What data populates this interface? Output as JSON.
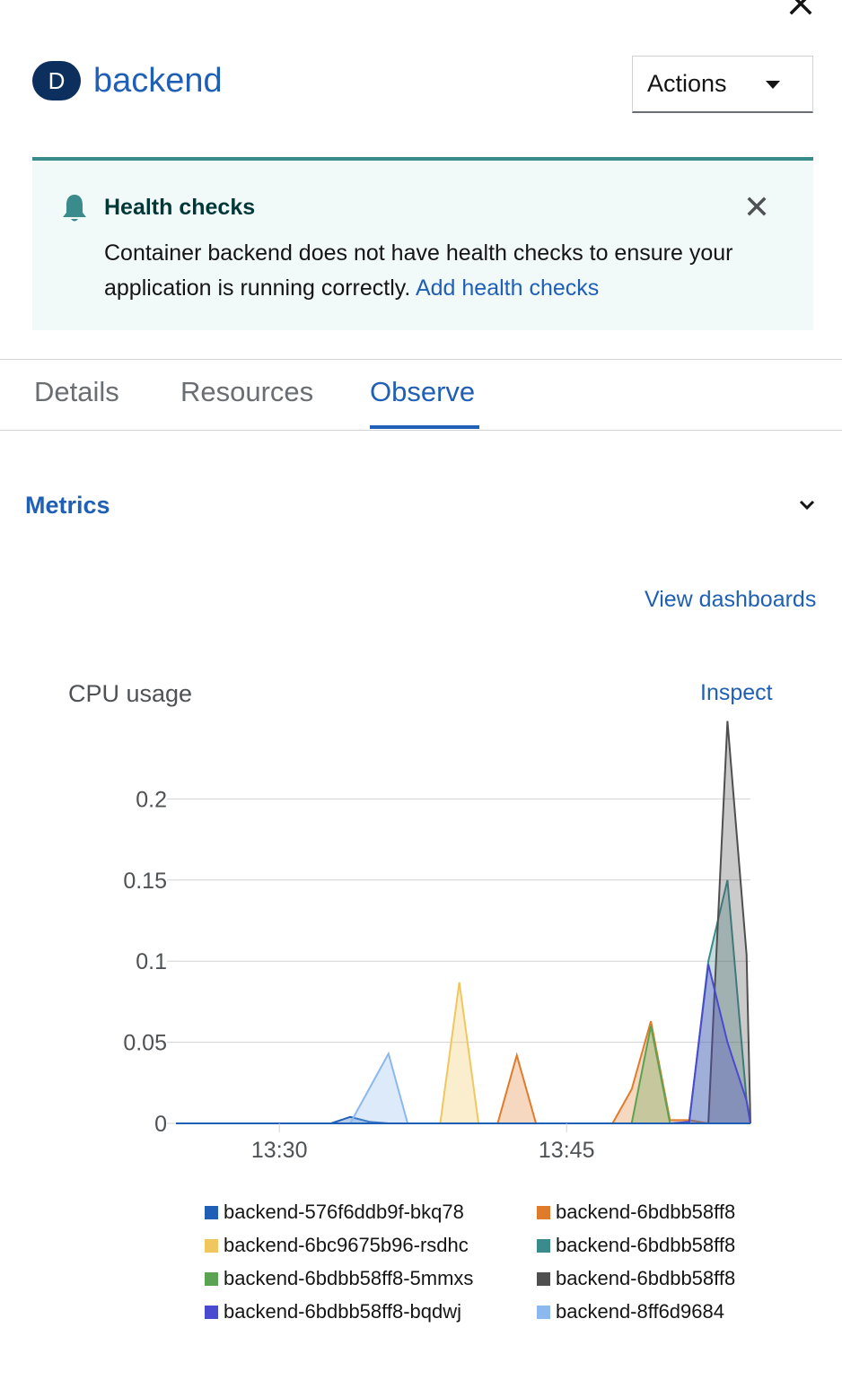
{
  "panel": {
    "close_icon": "close-icon",
    "kind_badge": "D",
    "resource_name": "backend",
    "actions_label": "Actions"
  },
  "alert": {
    "icon": "bell-icon",
    "title": "Health checks",
    "body": "Container backend does not have health checks to ensure your application is running correctly.",
    "link": "Add health checks"
  },
  "tabs": [
    {
      "label": "Details",
      "active": false
    },
    {
      "label": "Resources",
      "active": false
    },
    {
      "label": "Observe",
      "active": true
    }
  ],
  "metrics": {
    "title": "Metrics",
    "view_dashboards": "View dashboards",
    "card_title": "CPU usage",
    "inspect": "Inspect"
  },
  "chart_data": {
    "type": "area",
    "title": "CPU usage",
    "x_ticks": [
      "13:30",
      "13:45"
    ],
    "x_tick_minutes": [
      30,
      45
    ],
    "x_range_minutes": [
      24.6,
      54.6
    ],
    "y_ticks": [
      "0",
      "0.05",
      "0.1",
      "0.15",
      "0.2"
    ],
    "ylim": [
      0,
      0.25
    ],
    "grid": true,
    "legend_position": "bottom",
    "series": [
      {
        "name": "backend-576f6ddb9f-bkq78",
        "color": "#1f5fb5",
        "points": [
          [
            24.6,
            0
          ],
          [
            32.7,
            0
          ],
          [
            33.7,
            0.004
          ],
          [
            34.7,
            0.001
          ],
          [
            35.7,
            0
          ],
          [
            54.6,
            0
          ]
        ]
      },
      {
        "name": "backend-6bdbb58ff8",
        "color": "#e07b2c",
        "points": [
          [
            41.4,
            0
          ],
          [
            42.4,
            0.042
          ],
          [
            43.4,
            0
          ],
          [
            47.4,
            0
          ],
          [
            48.4,
            0.021
          ],
          [
            49.4,
            0.063
          ],
          [
            50.4,
            0.002
          ],
          [
            51.4,
            0.002
          ],
          [
            52.4,
            0
          ]
        ]
      },
      {
        "name": "backend-6bc9675b96-rsdhc",
        "color": "#f0c75e",
        "points": [
          [
            38.4,
            0
          ],
          [
            39.4,
            0.087
          ],
          [
            40.4,
            0
          ]
        ]
      },
      {
        "name": "backend-6bdbb58ff8",
        "color": "#3a8b8b",
        "points": [
          [
            51.4,
            0
          ],
          [
            52.4,
            0.1
          ],
          [
            53.4,
            0.15
          ],
          [
            54.4,
            0.014
          ],
          [
            54.6,
            0
          ]
        ]
      },
      {
        "name": "backend-6bdbb58ff8-5mmxs",
        "color": "#5ba352",
        "points": [
          [
            48.4,
            0
          ],
          [
            49.4,
            0.06
          ],
          [
            50.4,
            0
          ]
        ]
      },
      {
        "name": "backend-6bdbb58ff8",
        "color": "#4f4f4f",
        "points": [
          [
            52.4,
            0
          ],
          [
            53.4,
            0.248
          ],
          [
            54.4,
            0.104
          ],
          [
            54.6,
            0
          ]
        ]
      },
      {
        "name": "backend-6bdbb58ff8-bqdwj",
        "color": "#4a4ad1",
        "points": [
          [
            50.4,
            0
          ],
          [
            51.4,
            0.001
          ],
          [
            52.4,
            0.098
          ],
          [
            53.4,
            0.05
          ],
          [
            54.4,
            0.014
          ],
          [
            54.6,
            0
          ]
        ]
      },
      {
        "name": "backend-8ff6d9684",
        "color": "#8bb8ef",
        "points": [
          [
            33.7,
            0
          ],
          [
            35.7,
            0.043
          ],
          [
            36.7,
            0
          ]
        ]
      }
    ]
  }
}
